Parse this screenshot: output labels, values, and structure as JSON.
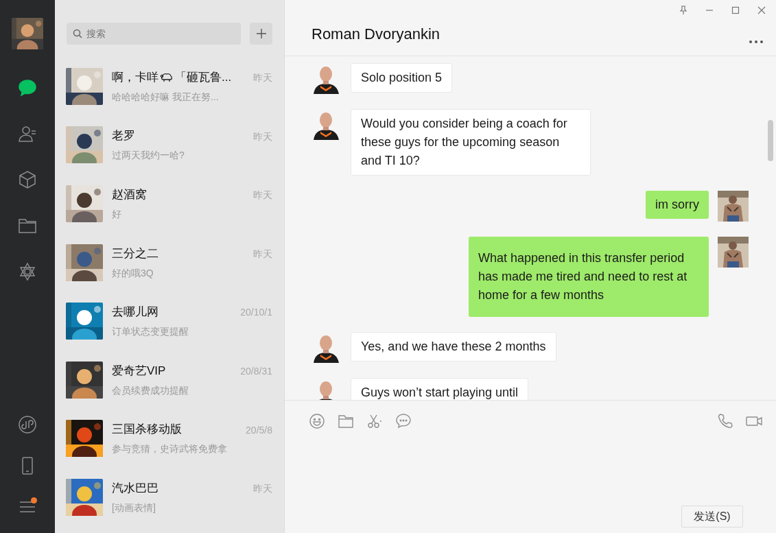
{
  "sidebar": {
    "items": [
      {
        "kind": "chats",
        "selected": true
      },
      {
        "kind": "contacts",
        "selected": false
      },
      {
        "kind": "favorites",
        "selected": false
      },
      {
        "kind": "files",
        "selected": false
      },
      {
        "kind": "moments",
        "selected": false
      }
    ],
    "bottom_items": [
      {
        "kind": "miniprogram",
        "badge": false
      },
      {
        "kind": "phone",
        "badge": false
      },
      {
        "kind": "menu",
        "badge": true
      }
    ]
  },
  "search": {
    "placeholder": "搜索"
  },
  "chats": [
    {
      "name": "啊，卡咩",
      "name_suffix": "「砸瓦鲁...",
      "preview": "哈哈哈哈好嘛 我正在努...",
      "time": "昨天"
    },
    {
      "name": "老罗",
      "preview": "过两天我约一哈?",
      "time": "昨天"
    },
    {
      "name": "赵酒窝",
      "preview": "好",
      "time": "昨天"
    },
    {
      "name": "三分之二",
      "preview": "好的哦3Q",
      "time": "昨天"
    },
    {
      "name": "去哪儿网",
      "preview": "订单状态变更提醒",
      "time": "20/10/1"
    },
    {
      "name": "爱奇艺VIP",
      "preview": "会员续费成功提醒",
      "time": "20/8/31"
    },
    {
      "name": "三国杀移动版",
      "preview": "参与竞猜，史诗武将免费拿",
      "time": "20/5/8"
    },
    {
      "name": "汽水巴巴",
      "preview": "[动画表情]",
      "time": "昨天"
    }
  ],
  "conversation": {
    "title": "Roman Dvoryankin",
    "messages": [
      {
        "kind": "incoming",
        "text": "Solo position 5"
      },
      {
        "kind": "incoming",
        "text": "Would you consider being a coach for these guys for the upcoming season and TI 10?"
      },
      {
        "kind": "outgoing",
        "text": "im sorry"
      },
      {
        "kind": "outgoing",
        "text": "What happened in this transfer period has made me tired and need to rest at home for a few months"
      },
      {
        "kind": "incoming",
        "text": "Yes, and we have these 2 months"
      },
      {
        "kind": "incoming",
        "text": "Guys won’t start playing until"
      }
    ]
  },
  "composer": {
    "send_label": "发送(S)"
  }
}
